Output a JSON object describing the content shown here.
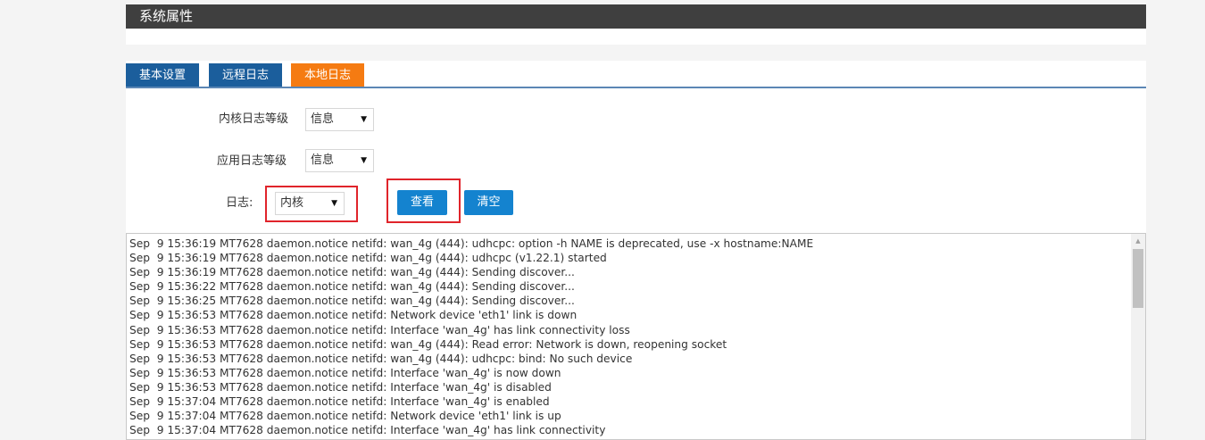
{
  "header": {
    "title": "系统属性"
  },
  "tabs": [
    {
      "label": "基本设置",
      "active": false
    },
    {
      "label": "远程日志",
      "active": false
    },
    {
      "label": "本地日志",
      "active": true
    }
  ],
  "form": {
    "kernel_log_level": {
      "label": "内核日志等级",
      "value": "信息"
    },
    "app_log_level": {
      "label": "应用日志等级",
      "value": "信息"
    },
    "log_source": {
      "label": "日志:",
      "value": "内核"
    },
    "view_button": "查看",
    "clear_button": "清空"
  },
  "log": {
    "lines": [
      "Sep  9 15:36:19 MT7628 daemon.notice netifd: wan_4g (444): udhcpc: option -h NAME is deprecated, use -x hostname:NAME",
      "Sep  9 15:36:19 MT7628 daemon.notice netifd: wan_4g (444): udhcpc (v1.22.1) started",
      "Sep  9 15:36:19 MT7628 daemon.notice netifd: wan_4g (444): Sending discover...",
      "Sep  9 15:36:22 MT7628 daemon.notice netifd: wan_4g (444): Sending discover...",
      "Sep  9 15:36:25 MT7628 daemon.notice netifd: wan_4g (444): Sending discover...",
      "Sep  9 15:36:53 MT7628 daemon.notice netifd: Network device 'eth1' link is down",
      "Sep  9 15:36:53 MT7628 daemon.notice netifd: Interface 'wan_4g' has link connectivity loss",
      "Sep  9 15:36:53 MT7628 daemon.notice netifd: wan_4g (444): Read error: Network is down, reopening socket",
      "Sep  9 15:36:53 MT7628 daemon.notice netifd: wan_4g (444): udhcpc: bind: No such device",
      "Sep  9 15:36:53 MT7628 daemon.notice netifd: Interface 'wan_4g' is now down",
      "Sep  9 15:36:53 MT7628 daemon.notice netifd: Interface 'wan_4g' is disabled",
      "Sep  9 15:37:04 MT7628 daemon.notice netifd: Interface 'wan_4g' is enabled",
      "Sep  9 15:37:04 MT7628 daemon.notice netifd: Network device 'eth1' link is up",
      "Sep  9 15:37:04 MT7628 daemon.notice netifd: Interface 'wan_4g' has link connectivity"
    ]
  },
  "icons": {
    "select_arrow": "dropdown-arrow-icon",
    "scroll_up": "scroll-up-arrow-icon"
  },
  "colors": {
    "header_bg": "#3f3f3f",
    "tab_inactive": "#1b5e9c",
    "tab_active": "#f57b12",
    "button": "#1483cf",
    "highlight_box": "#e0242b"
  }
}
